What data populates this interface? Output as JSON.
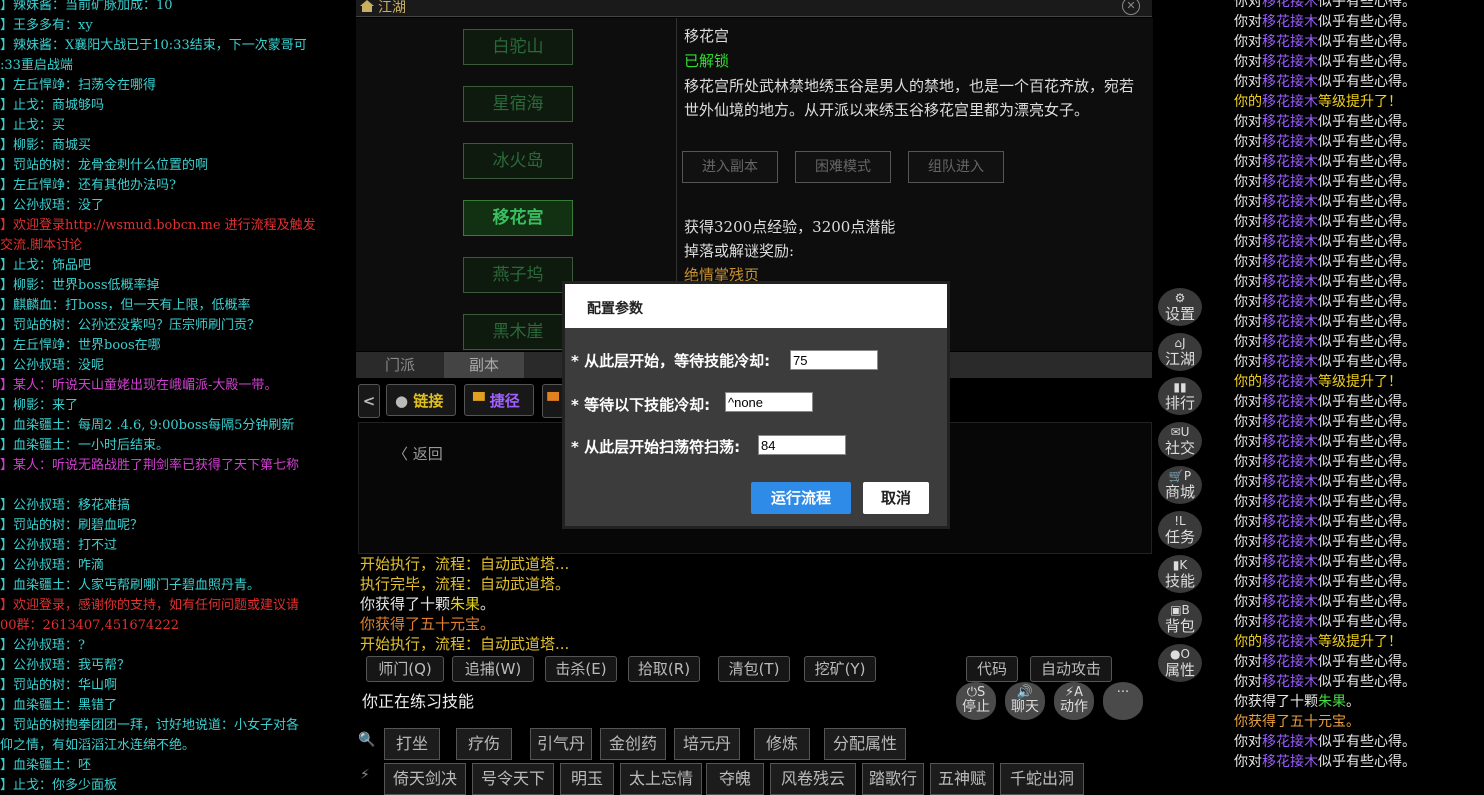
{
  "chat": {
    "lines": [
      {
        "text": "】辣妹酱：当前矿脉加成：10",
        "color": "#3ad0d0"
      },
      {
        "text": "】王多多有：xy",
        "color": "#3ad0d0"
      },
      {
        "text": "】辣妹酱：X襄阳大战已于10:33结束，下一次蒙哥可",
        "color": "#3ad0d0"
      },
      {
        "text": ":33重启战端",
        "color": "#3ad0d0"
      },
      {
        "text": "】左丘悍竫：扫荡令在哪得",
        "color": "#3ad0d0"
      },
      {
        "text": "】止戈：商城够吗",
        "color": "#3ad0d0"
      },
      {
        "text": "】止戈：买",
        "color": "#3ad0d0"
      },
      {
        "text": "】柳影：商城买",
        "color": "#3ad0d0"
      },
      {
        "text": "】罚站的树：龙骨金刺什么位置的啊",
        "color": "#3ad0d0"
      },
      {
        "text": "】左丘悍竫：还有其他办法吗?",
        "color": "#3ad0d0"
      },
      {
        "text": "】公孙叔珸：没了",
        "color": "#3ad0d0"
      },
      {
        "text": "】欢迎登录http://wsmud.bobcn.me 进行流程及触发",
        "color": "#e03030"
      },
      {
        "text": "交流.脚本讨论",
        "color": "#e03030"
      },
      {
        "text": "】止戈：饰品吧",
        "color": "#3ad0d0"
      },
      {
        "text": "】柳影：世界boss低概率掉",
        "color": "#3ad0d0"
      },
      {
        "text": "】麒麟血：打boss，但一天有上限，低概率",
        "color": "#3ad0d0"
      },
      {
        "text": "】罚站的树：公孙还没紫吗？压宗师刷门贡？",
        "color": "#3ad0d0"
      },
      {
        "text": "】左丘悍竫：世界boos在哪",
        "color": "#3ad0d0"
      },
      {
        "text": "】公孙叔珸：没呢",
        "color": "#3ad0d0"
      },
      {
        "text": "】某人：听说天山童姥出现在峨嵋派-大殿一带。",
        "color": "#d040d0"
      },
      {
        "text": "】柳影：来了",
        "color": "#3ad0d0"
      },
      {
        "text": "】血染疆土：每周2 .4.6, 9:00boss每隔5分钟刷新",
        "color": "#3ad0d0"
      },
      {
        "text": "】血染疆土：一小时后结束。",
        "color": "#3ad0d0"
      },
      {
        "text": "】某人：听说无路战胜了荆剑率已获得了天下第七称",
        "color": "#d040d0"
      },
      {
        "text": "",
        "color": "#3ad0d0"
      },
      {
        "text": "】公孙叔珸：移花难搞",
        "color": "#3ad0d0"
      },
      {
        "text": "】罚站的树：刷碧血呢？",
        "color": "#3ad0d0"
      },
      {
        "text": "】公孙叔珸：打不过",
        "color": "#3ad0d0"
      },
      {
        "text": "】公孙叔珸：咋滴",
        "color": "#3ad0d0"
      },
      {
        "text": "】血染疆土：人家丐帮刷哪门子碧血照丹青。",
        "color": "#3ad0d0"
      },
      {
        "text": "】欢迎登录，感谢你的支持，如有任何问题或建议请",
        "color": "#e03030"
      },
      {
        "text": "00群：2613407,451674222",
        "color": "#e03030"
      },
      {
        "text": "】公孙叔珸：?",
        "color": "#3ad0d0"
      },
      {
        "text": "】公孙叔珸：我丐帮？",
        "color": "#3ad0d0"
      },
      {
        "text": "】罚站的树：华山啊",
        "color": "#3ad0d0"
      },
      {
        "text": "】血染疆土：黑错了",
        "color": "#3ad0d0"
      },
      {
        "text": "】罚站的树抱拳团团一拜，讨好地说道：小女子对各",
        "color": "#3ad0d0"
      },
      {
        "text": "仰之情，有如滔滔江水连绵不绝。",
        "color": "#3ad0d0"
      },
      {
        "text": "】血染疆土：呸",
        "color": "#3ad0d0"
      },
      {
        "text": "】止戈：你多少面板",
        "color": "#3ad0d0"
      }
    ]
  },
  "header": {
    "title": "江湖"
  },
  "sects": [
    "白驼山",
    "星宿海",
    "冰火岛",
    "移花宫",
    "燕子坞",
    "黑木崖"
  ],
  "sect_selected": 3,
  "detail": {
    "name": "移花宫",
    "status": "已解锁",
    "desc": "移花宫所处武林禁地绣玉谷是男人的禁地，也是一个百花齐放，宛若世外仙境的地方。从开派以来绣玉谷移花宫里都为漂亮女子。",
    "buttons": [
      "进入副本",
      "困难模式",
      "组队进入"
    ],
    "reward": "获得3200点经验，3200点潜能",
    "drop_label": "掉落或解谜奖励:",
    "drop_item": "绝情掌残页"
  },
  "tabs": [
    "门派",
    "副本"
  ],
  "quick": [
    {
      "label": "链接",
      "icon": "●"
    },
    {
      "label": "捷径",
      "icon": "■"
    }
  ],
  "panel": {
    "back": "返回"
  },
  "msglog": [
    {
      "text": "开始执行，流程：自动武道塔...",
      "color": "#e0c030"
    },
    {
      "text": "执行完毕，流程：自动武道塔。",
      "color": "#e0c030"
    },
    {
      "parts": [
        {
          "text": "你获得了十颗",
          "color": "#e6e6e6"
        },
        {
          "text": "朱果",
          "color": "#e0d020"
        },
        {
          "text": "。",
          "color": "#e6e6e6"
        }
      ]
    },
    {
      "text": "你获得了五十元宝。",
      "color": "#e08030"
    },
    {
      "text": "开始执行，流程：自动武道塔...",
      "color": "#e0c030"
    }
  ],
  "commands": [
    "师门(Q)",
    "追捕(W)",
    "击杀(E)",
    "拾取(R)",
    "清包(T)",
    "挖矿(Y)",
    "代码",
    "自动攻击"
  ],
  "status_text": "你正在练习技能",
  "action_btns": [
    {
      "glyph": "⏻S",
      "label": "停止"
    },
    {
      "glyph": "🔊",
      "label": "聊天"
    },
    {
      "glyph": "⚡A",
      "label": "动作"
    },
    {
      "glyph": "···",
      "label": ""
    }
  ],
  "skills1": [
    "打坐",
    "疗伤",
    "引气丹",
    "金创药",
    "培元丹",
    "修炼",
    "分配属性"
  ],
  "skills2": [
    "倚天剑决",
    "号令天下",
    "明玉",
    "太上忘情",
    "夺魄",
    "风卷残云",
    "踏歌行",
    "五神赋",
    "千蛇出洞"
  ],
  "sidebar": [
    {
      "glyph": "⚙",
      "label": "设置"
    },
    {
      "glyph": "⌂J",
      "label": "江湖"
    },
    {
      "glyph": "▮▮",
      "label": "排行"
    },
    {
      "glyph": "✉U",
      "label": "社交"
    },
    {
      "glyph": "🛒P",
      "label": "商城"
    },
    {
      "glyph": "!L",
      "label": "任务"
    },
    {
      "glyph": "▮K",
      "label": "技能"
    },
    {
      "glyph": "▣B",
      "label": "背包"
    },
    {
      "glyph": "●O",
      "label": "属性"
    }
  ],
  "rlog": [
    {
      "kind": "xd"
    },
    {
      "kind": "xd"
    },
    {
      "kind": "xd"
    },
    {
      "kind": "xd"
    },
    {
      "kind": "xd"
    },
    {
      "kind": "lv"
    },
    {
      "kind": "xd"
    },
    {
      "kind": "xd"
    },
    {
      "kind": "xd"
    },
    {
      "kind": "xd"
    },
    {
      "kind": "xd"
    },
    {
      "kind": "xd"
    },
    {
      "kind": "xd"
    },
    {
      "kind": "xd"
    },
    {
      "kind": "xd"
    },
    {
      "kind": "xd"
    },
    {
      "kind": "xd"
    },
    {
      "kind": "xd"
    },
    {
      "kind": "xd"
    },
    {
      "kind": "lv"
    },
    {
      "kind": "xd"
    },
    {
      "kind": "xd"
    },
    {
      "kind": "xd"
    },
    {
      "kind": "xd"
    },
    {
      "kind": "xd"
    },
    {
      "kind": "xd"
    },
    {
      "kind": "xd"
    },
    {
      "kind": "xd"
    },
    {
      "kind": "xd"
    },
    {
      "kind": "xd"
    },
    {
      "kind": "xd"
    },
    {
      "kind": "xd"
    },
    {
      "kind": "lv"
    },
    {
      "kind": "xd"
    },
    {
      "kind": "xd"
    },
    {
      "kind": "gz"
    },
    {
      "kind": "gy"
    },
    {
      "kind": "xd"
    },
    {
      "kind": "xd"
    }
  ],
  "rlog_text": {
    "xd_a": "你对",
    "xd_b": "移花接木",
    "xd_c": "似乎有些心得。",
    "lv_a": "你的",
    "lv_b": "移花接木",
    "lv_c": "等级提升了！",
    "gz_a": "你获得了十颗",
    "gz_b": "朱果",
    "gz_c": "。",
    "gy": "你获得了五十元宝。"
  },
  "modal": {
    "title": "配置参数",
    "rows": [
      {
        "label": "* 从此层开始，等待技能冷却:",
        "value": "75"
      },
      {
        "label": "* 等待以下技能冷却:",
        "value": "^none"
      },
      {
        "label": "* 从此层开始扫荡符扫荡:",
        "value": "84"
      }
    ],
    "run": "运行流程",
    "cancel": "取消"
  }
}
